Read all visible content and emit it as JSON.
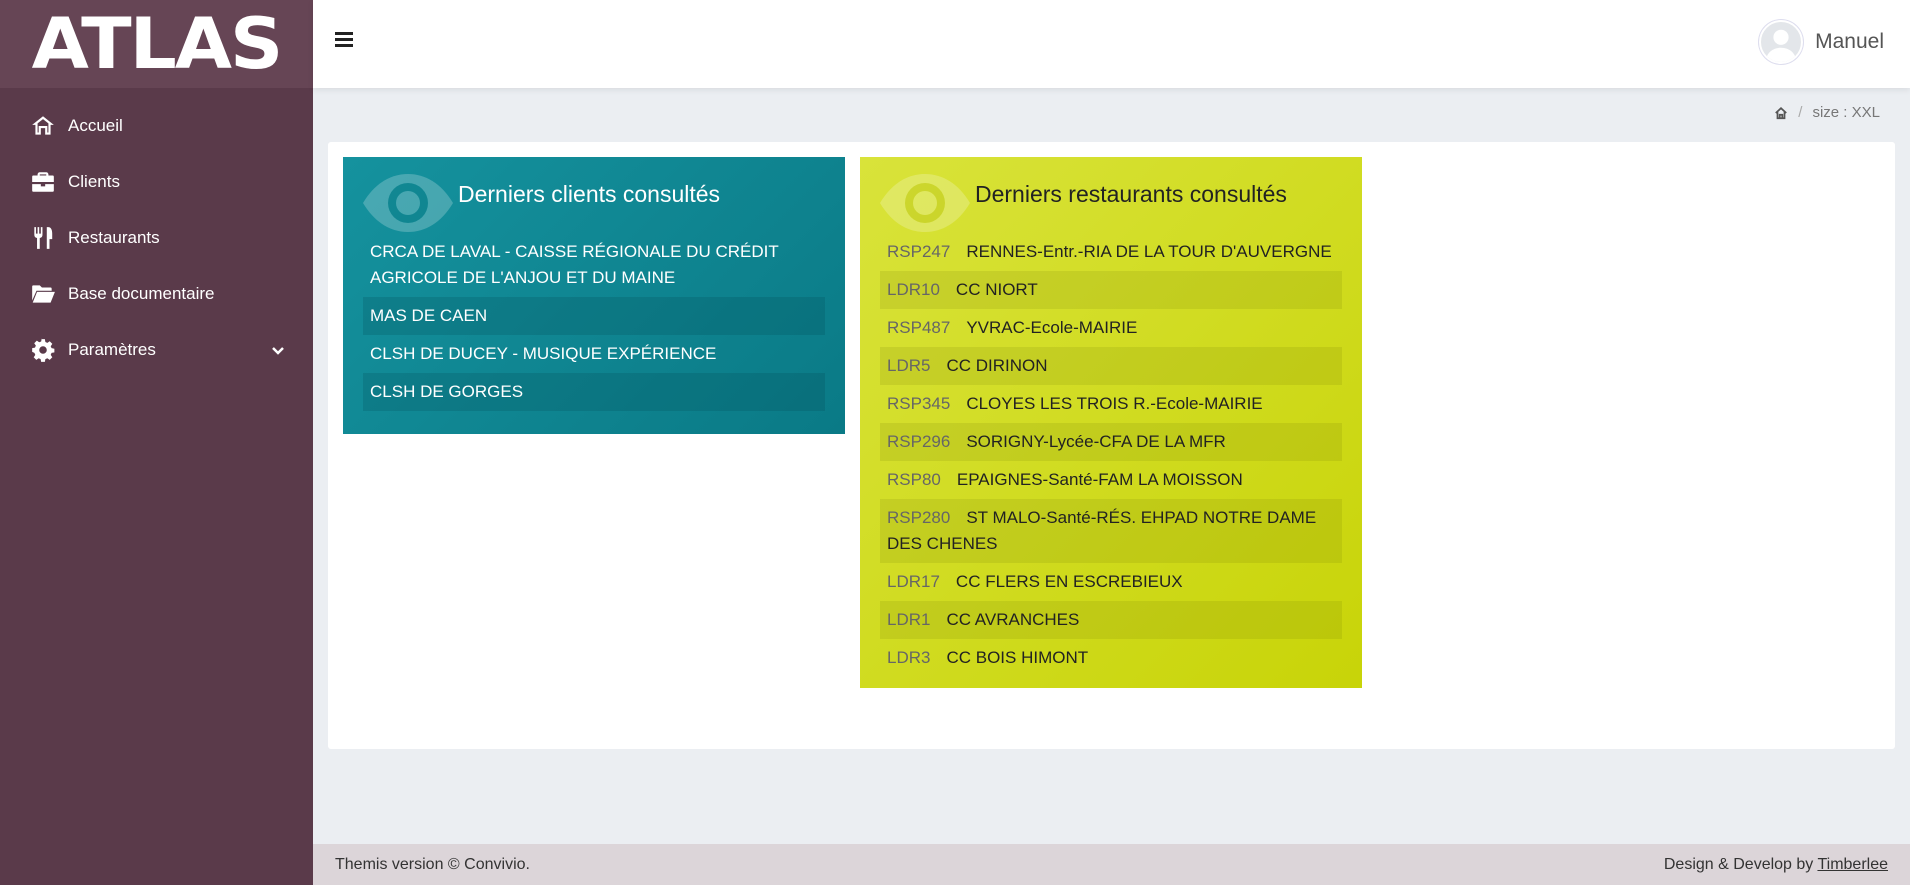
{
  "app": {
    "logo": "ATLAS"
  },
  "sidebar": {
    "items": [
      {
        "label": "Accueil",
        "icon": "home-icon"
      },
      {
        "label": "Clients",
        "icon": "briefcase-icon"
      },
      {
        "label": "Restaurants",
        "icon": "cutlery-icon"
      },
      {
        "label": "Base documentaire",
        "icon": "folder-open-icon"
      },
      {
        "label": "Paramètres",
        "icon": "gear-icon"
      }
    ]
  },
  "header": {
    "user_name": "Manuel"
  },
  "breadcrumb": {
    "current": "size : XXL"
  },
  "clients_card": {
    "title": "Derniers clients consultés",
    "items": [
      "CRCA DE LAVAL - CAISSE RÉGIONALE DU CRÉDIT AGRICOLE DE L'ANJOU ET DU MAINE",
      "MAS DE CAEN",
      "CLSH DE DUCEY - MUSIQUE EXPÉRIENCE",
      "CLSH DE GORGES"
    ]
  },
  "restaurants_card": {
    "title": "Derniers restaurants consultés",
    "items": [
      {
        "code": "RSP247",
        "name": "RENNES-Entr.-RIA DE LA TOUR D'AUVERGNE"
      },
      {
        "code": "LDR10",
        "name": "CC NIORT"
      },
      {
        "code": "RSP487",
        "name": "YVRAC-Ecole-MAIRIE"
      },
      {
        "code": "LDR5",
        "name": "CC DIRINON"
      },
      {
        "code": "RSP345",
        "name": "CLOYES LES TROIS R.-Ecole-MAIRIE"
      },
      {
        "code": "RSP296",
        "name": "SORIGNY-Lycée-CFA DE LA MFR"
      },
      {
        "code": "RSP80",
        "name": "EPAIGNES-Santé-FAM LA MOISSON"
      },
      {
        "code": "RSP280",
        "name": "ST MALO-Santé-RÉS. EHPAD NOTRE DAME DES CHENES"
      },
      {
        "code": "LDR17",
        "name": "CC FLERS EN ESCREBIEUX"
      },
      {
        "code": "LDR1",
        "name": "CC AVRANCHES"
      },
      {
        "code": "LDR3",
        "name": "CC BOIS HIMONT"
      }
    ]
  },
  "footer": {
    "left": "Themis version © Convivio.",
    "right_prefix": "Design & Develop by ",
    "right_link": "Timberlee"
  },
  "colors": {
    "sidebar": "#5a3a4a",
    "clients_card": "#0f8a95",
    "restaurants_card": "#d0db1e"
  }
}
